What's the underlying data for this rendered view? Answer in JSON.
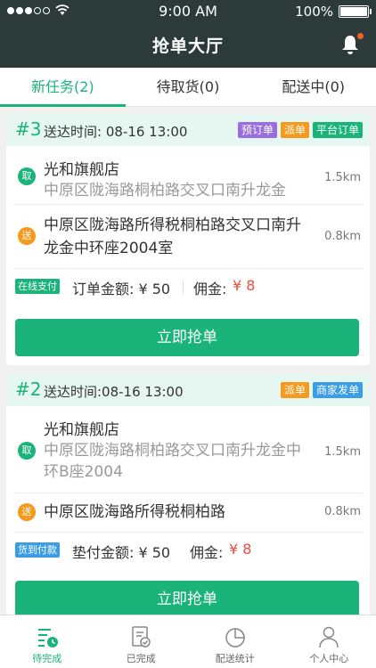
{
  "status_bar": {
    "time": "9:00 AM",
    "battery": "100%"
  },
  "header": {
    "title": "抢单大厅"
  },
  "tabs": [
    {
      "label": "新任务(2)",
      "active": true
    },
    {
      "label": "待取货(0)",
      "active": false
    },
    {
      "label": "配送中(0)",
      "active": false
    }
  ],
  "orders": [
    {
      "number": "#3",
      "deliver_time": "送达时间: 08-16 13:00",
      "tags": [
        "预订单",
        "派单",
        "平台订单"
      ],
      "pickup": {
        "badge": "取",
        "name": "光和旗舰店",
        "address": "中原区陇海路桐柏路交叉口南升龙金",
        "distance": "1.5km"
      },
      "dropoff": {
        "badge": "送",
        "address": "中原区陇海路所得税桐柏路交叉口南升龙金中环座2004室",
        "distance": "0.8km"
      },
      "payment_tag": "在线支付",
      "amount_label": "订单金额: ¥ 50",
      "commission_label": "佣金:",
      "commission_value": "¥ 8",
      "button": "立即抢单"
    },
    {
      "number": "#2",
      "deliver_time": "送达时间:08-16 13:00",
      "tags": [
        "派单",
        "商家发单"
      ],
      "pickup": {
        "badge": "取",
        "name": "光和旗舰店",
        "address": "中原区陇海路桐柏路交叉口南升龙金中环B座2004",
        "distance": "1.5km"
      },
      "dropoff": {
        "badge": "送",
        "address": "中原区陇海路所得税桐柏路",
        "distance": "0.8km"
      },
      "payment_tag": "货到付款",
      "amount_label": "垫付金额: ¥ 50",
      "commission_label": "佣金:",
      "commission_value": "¥ 8",
      "button": "立即抢单"
    }
  ],
  "tabbar": [
    {
      "label": "待完成",
      "icon": "task-list-clock-icon",
      "active": true
    },
    {
      "label": "已完成",
      "icon": "document-check-icon",
      "active": false
    },
    {
      "label": "配送统计",
      "icon": "pie-chart-icon",
      "active": false
    },
    {
      "label": "个人中心",
      "icon": "person-icon",
      "active": false
    }
  ],
  "colors": {
    "header_bg": "#2d3a3a",
    "accent": "#1ab47a",
    "price_red": "#f04b3a"
  }
}
